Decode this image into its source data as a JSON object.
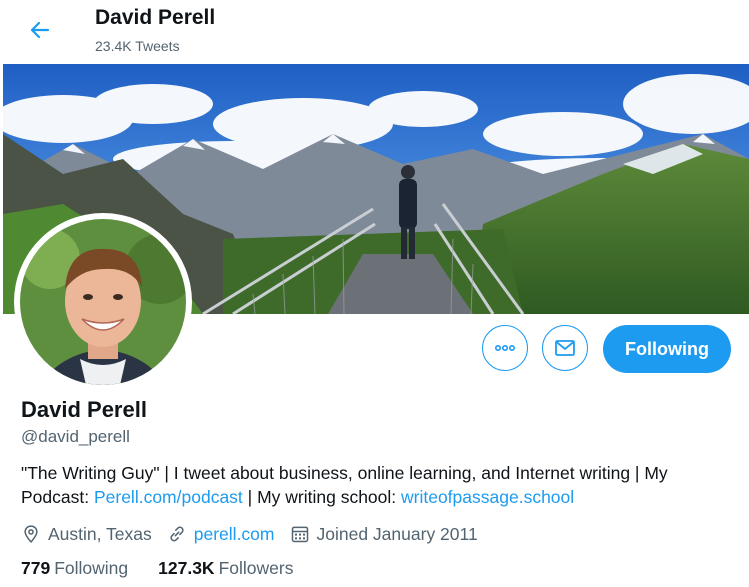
{
  "header": {
    "name": "David Perell",
    "tweet_count": "23.4K Tweets"
  },
  "actions": {
    "following_label": "Following"
  },
  "profile": {
    "name": "David Perell",
    "handle": "@david_perell",
    "bio_part1": "\"The Writing Guy\" | I tweet about business, online learning, and Internet writing | My Podcast: ",
    "bio_link1": "Perell.com/podcast",
    "bio_part2": " | My writing school: ",
    "bio_link2": "writeofpassage.school",
    "location": "Austin, Texas",
    "website": "perell.com",
    "joined": "Joined January 2011"
  },
  "stats": {
    "following_count": "779",
    "following_label": "Following",
    "followers_count": "127.3K",
    "followers_label": "Followers"
  },
  "colors": {
    "accent": "#1d9bf0",
    "secondary_text": "#536471",
    "primary_text": "#0f1419"
  },
  "icons": [
    "arrow-left-icon",
    "more-icon",
    "mail-icon",
    "location-icon",
    "link-icon",
    "calendar-icon"
  ]
}
